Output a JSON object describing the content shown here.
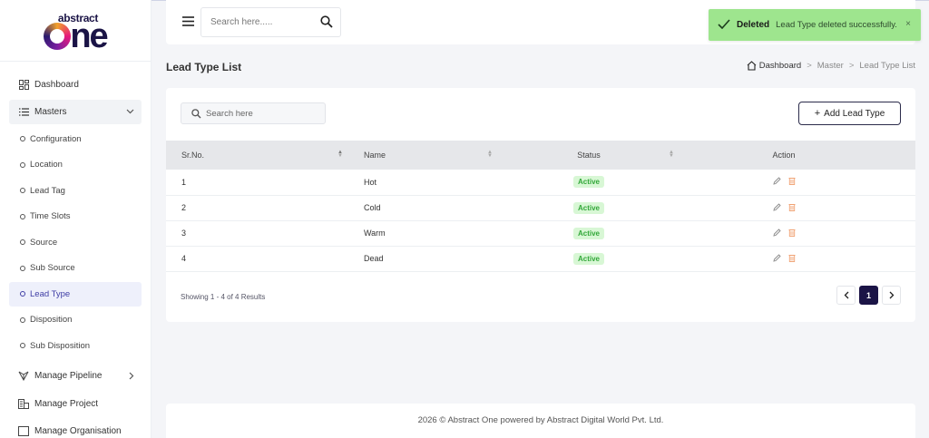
{
  "brand": {
    "line1": "abstract",
    "line2_o": "o",
    "line2_rest": "ne"
  },
  "sidebar": {
    "items": [
      {
        "label": "Dashboard"
      },
      {
        "label": "Masters"
      }
    ],
    "masters_sub": [
      {
        "label": "Configuration"
      },
      {
        "label": "Location"
      },
      {
        "label": "Lead Tag"
      },
      {
        "label": "Time Slots"
      },
      {
        "label": "Source"
      },
      {
        "label": "Sub Source"
      },
      {
        "label": "Lead Type"
      },
      {
        "label": "Disposition"
      },
      {
        "label": "Sub Disposition"
      }
    ],
    "bottom_items": [
      {
        "label": "Manage Pipeline"
      },
      {
        "label": "Manage Project"
      },
      {
        "label": "Manage Organisation"
      }
    ]
  },
  "topbar": {
    "search_placeholder": "Search here....."
  },
  "toast": {
    "title": "Deleted",
    "message": "Lead Type deleted successfully.",
    "close": "×"
  },
  "page": {
    "title": "Lead Type List"
  },
  "breadcrumb": {
    "home": "Dashboard",
    "sep": ">",
    "mid": "Master",
    "current": "Lead Type List"
  },
  "list": {
    "search_placeholder": "Search here",
    "add_button": "Add Lead Type",
    "columns": [
      "Sr.No.",
      "Name",
      "Status",
      "Action"
    ],
    "rows": [
      {
        "sr": "1",
        "name": "Hot",
        "status": "Active"
      },
      {
        "sr": "2",
        "name": "Cold",
        "status": "Active"
      },
      {
        "sr": "3",
        "name": "Warm",
        "status": "Active"
      },
      {
        "sr": "4",
        "name": "Dead",
        "status": "Active"
      }
    ],
    "showing": "Showing 1 - 4 of 4 Results",
    "current_page": "1"
  },
  "footer": {
    "text": "2026 © Abstract One powered by Abstract Digital World Pvt. Ltd."
  },
  "colors": {
    "brand": "#1b1446",
    "toast_bg": "#9ee58e",
    "active_badge": "#33a83a",
    "active_nav": "#3f3ea5",
    "delete_icon": "#f0a070"
  }
}
